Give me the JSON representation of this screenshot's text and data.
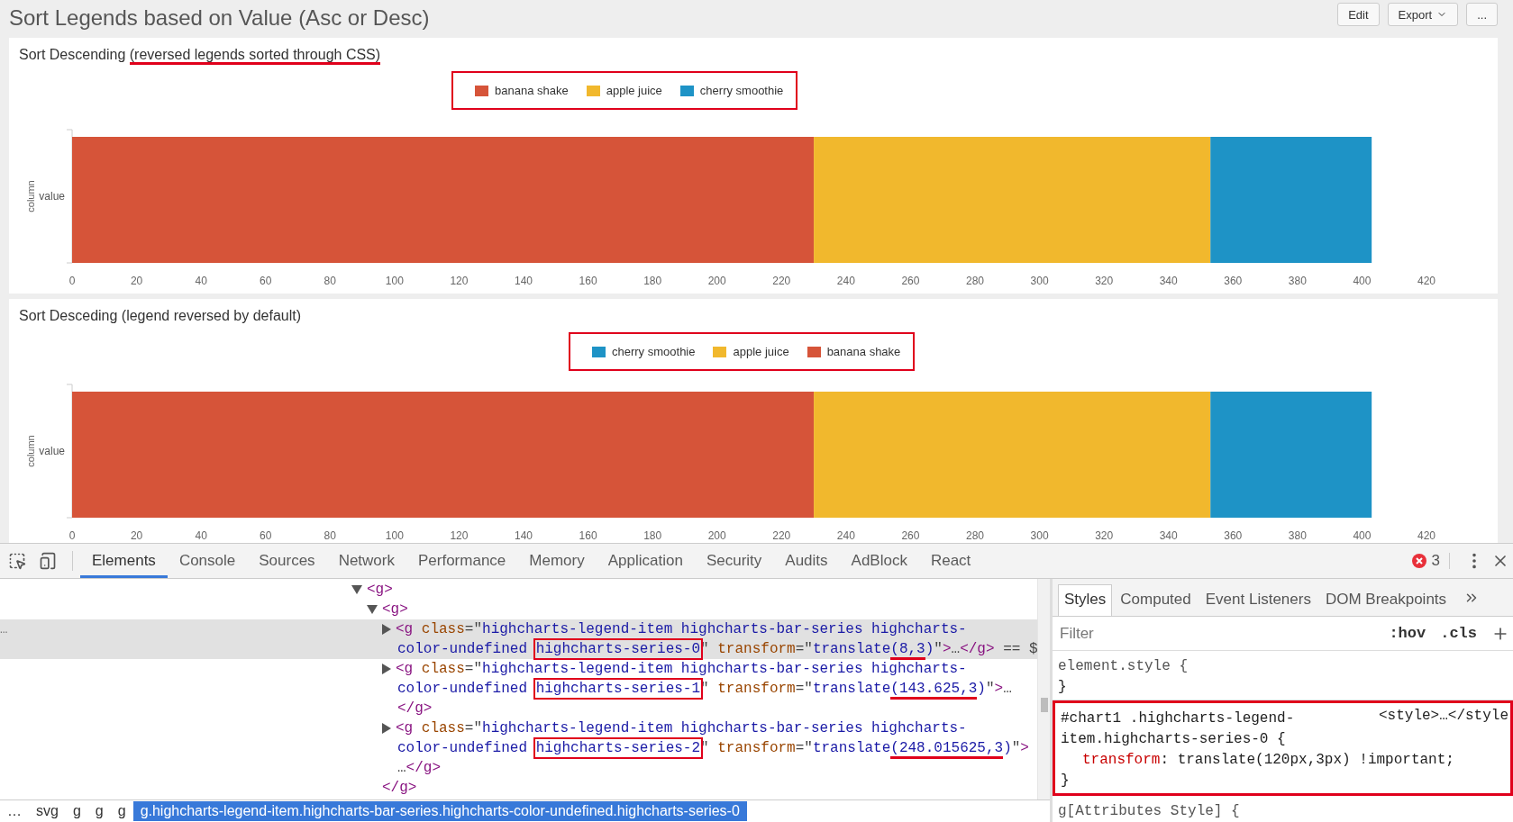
{
  "header": {
    "title": "Sort Legends based on Value (Asc or Desc)",
    "buttons": [
      {
        "label": "Edit",
        "dropdown": false
      },
      {
        "label": "Export",
        "dropdown": true
      },
      {
        "label": "...",
        "dropdown": false
      }
    ]
  },
  "charts": [
    {
      "title": [
        {
          "text": "Sort Descending ",
          "underlined": false
        },
        {
          "text": "(reversed legends sorted through CSS)",
          "underlined": true
        }
      ],
      "chart_data": {
        "type": "bar",
        "orientation": "horizontal",
        "stacked": true,
        "legend": {
          "reversed": false,
          "highlighted": true
        },
        "ylabel": "column",
        "categories": [
          "value"
        ],
        "series": [
          {
            "name": "banana shake",
            "color": "#d65439",
            "values": [
              230
            ]
          },
          {
            "name": "apple juice",
            "color": "#f1b82d",
            "values": [
              123
            ]
          },
          {
            "name": "cherry smoothie",
            "color": "#1e93c6",
            "values": [
              50
            ]
          }
        ],
        "xlim": [
          0,
          420
        ],
        "xticks": [
          0,
          20,
          40,
          60,
          80,
          100,
          120,
          140,
          160,
          180,
          200,
          220,
          240,
          260,
          280,
          300,
          320,
          340,
          360,
          380,
          400,
          420
        ]
      }
    },
    {
      "title": [
        {
          "text": "Sort Desceding (legend reversed by default)",
          "underlined": false
        }
      ],
      "chart_data": {
        "type": "bar",
        "orientation": "horizontal",
        "stacked": true,
        "legend": {
          "reversed": true,
          "highlighted": true
        },
        "ylabel": "column",
        "categories": [
          "value"
        ],
        "series": [
          {
            "name": "banana shake",
            "color": "#d65439",
            "values": [
              230
            ]
          },
          {
            "name": "apple juice",
            "color": "#f1b82d",
            "values": [
              123
            ]
          },
          {
            "name": "cherry smoothie",
            "color": "#1e93c6",
            "values": [
              50
            ]
          }
        ],
        "xlim": [
          0,
          420
        ],
        "xticks": [
          0,
          20,
          40,
          60,
          80,
          100,
          120,
          140,
          160,
          180,
          200,
          220,
          240,
          260,
          280,
          300,
          320,
          340,
          360,
          380,
          400,
          420
        ]
      }
    }
  ],
  "devtools": {
    "toolbar": {
      "tabs": [
        {
          "label": "Elements",
          "selected": true
        },
        {
          "label": "Console",
          "selected": false
        },
        {
          "label": "Sources",
          "selected": false
        },
        {
          "label": "Network",
          "selected": false
        },
        {
          "label": "Performance",
          "selected": false
        },
        {
          "label": "Memory",
          "selected": false
        },
        {
          "label": "Application",
          "selected": false
        },
        {
          "label": "Security",
          "selected": false
        },
        {
          "label": "Audits",
          "selected": false
        },
        {
          "label": "AdBlock",
          "selected": false
        },
        {
          "label": "React",
          "selected": false
        }
      ],
      "error_count": "3"
    },
    "tree": [
      {
        "expanded": true,
        "selected": false,
        "lines": [
          [
            {
              "kind": "tag",
              "text": "<g>"
            }
          ]
        ],
        "children": [
          {
            "expanded": true,
            "selected": false,
            "lines": [
              [
                {
                  "kind": "tag",
                  "text": "<g>"
                }
              ]
            ],
            "children": [
              {
                "expanded": false,
                "selected": true,
                "gutter": "…",
                "lines": [
                  [
                    {
                      "kind": "tag",
                      "text": "<g "
                    },
                    {
                      "kind": "attr",
                      "text": "class"
                    },
                    {
                      "kind": "punct",
                      "text": "=\""
                    },
                    {
                      "kind": "value",
                      "text": "highcharts-legend-item highcharts-bar-series highcharts-"
                    }
                  ],
                  [
                    {
                      "kind": "value",
                      "text": "color-undefined "
                    },
                    {
                      "kind": "value",
                      "text": "highcharts-series-0",
                      "boxed": true
                    },
                    {
                      "kind": "punct",
                      "text": "\" "
                    },
                    {
                      "kind": "attr",
                      "text": "transform"
                    },
                    {
                      "kind": "punct",
                      "text": "=\""
                    },
                    {
                      "kind": "value",
                      "text": "translate"
                    },
                    {
                      "kind": "value",
                      "text": "(8,3",
                      "underlined": true
                    },
                    {
                      "kind": "value",
                      "text": ")"
                    },
                    {
                      "kind": "punct",
                      "text": "\""
                    },
                    {
                      "kind": "tag",
                      "text": ">"
                    },
                    {
                      "kind": "punct",
                      "text": "…"
                    },
                    {
                      "kind": "tag",
                      "text": "</g>"
                    },
                    {
                      "kind": "punct",
                      "text": " == $"
                    }
                  ]
                ]
              },
              {
                "expanded": false,
                "selected": false,
                "lines": [
                  [
                    {
                      "kind": "tag",
                      "text": "<g "
                    },
                    {
                      "kind": "attr",
                      "text": "class"
                    },
                    {
                      "kind": "punct",
                      "text": "=\""
                    },
                    {
                      "kind": "value",
                      "text": "highcharts-legend-item highcharts-bar-series highcharts-"
                    }
                  ],
                  [
                    {
                      "kind": "value",
                      "text": "color-undefined "
                    },
                    {
                      "kind": "value",
                      "text": "highcharts-series-1",
                      "boxed": true
                    },
                    {
                      "kind": "punct",
                      "text": "\" "
                    },
                    {
                      "kind": "attr",
                      "text": "transform"
                    },
                    {
                      "kind": "punct",
                      "text": "=\""
                    },
                    {
                      "kind": "value",
                      "text": "translate"
                    },
                    {
                      "kind": "value",
                      "text": "(143.625,3",
                      "underlined": true
                    },
                    {
                      "kind": "value",
                      "text": ")"
                    },
                    {
                      "kind": "punct",
                      "text": "\""
                    },
                    {
                      "kind": "tag",
                      "text": ">"
                    },
                    {
                      "kind": "punct",
                      "text": "…"
                    }
                  ],
                  [
                    {
                      "kind": "tag",
                      "text": "</g>"
                    }
                  ]
                ]
              },
              {
                "expanded": false,
                "selected": false,
                "lines": [
                  [
                    {
                      "kind": "tag",
                      "text": "<g "
                    },
                    {
                      "kind": "attr",
                      "text": "class"
                    },
                    {
                      "kind": "punct",
                      "text": "=\""
                    },
                    {
                      "kind": "value",
                      "text": "highcharts-legend-item highcharts-bar-series highcharts-"
                    }
                  ],
                  [
                    {
                      "kind": "value",
                      "text": "color-undefined "
                    },
                    {
                      "kind": "value",
                      "text": "highcharts-series-2",
                      "boxed": true
                    },
                    {
                      "kind": "punct",
                      "text": "\" "
                    },
                    {
                      "kind": "attr",
                      "text": "transform"
                    },
                    {
                      "kind": "punct",
                      "text": "=\""
                    },
                    {
                      "kind": "value",
                      "text": "translate"
                    },
                    {
                      "kind": "value",
                      "text": "(248.015625,3",
                      "underlined": true
                    },
                    {
                      "kind": "value",
                      "text": ")"
                    },
                    {
                      "kind": "punct",
                      "text": "\""
                    },
                    {
                      "kind": "tag",
                      "text": ">"
                    }
                  ],
                  [
                    {
                      "kind": "punct",
                      "text": "…"
                    },
                    {
                      "kind": "tag",
                      "text": "</g>"
                    }
                  ]
                ]
              }
            ],
            "closing": [
              [
                {
                  "kind": "tag",
                  "text": "</g>"
                }
              ]
            ]
          }
        ]
      }
    ],
    "breadcrumbs": [
      {
        "label": "…",
        "selected": false
      },
      {
        "label": "svg",
        "selected": false
      },
      {
        "label": "g",
        "selected": false
      },
      {
        "label": "g",
        "selected": false
      },
      {
        "label": "g",
        "selected": false
      },
      {
        "label": "g.highcharts-legend-item.highcharts-bar-series.highcharts-color-undefined.highcharts-series-0",
        "selected": true
      }
    ],
    "styles_pane": {
      "tabs": [
        {
          "label": "Styles",
          "selected": true
        },
        {
          "label": "Computed",
          "selected": false
        },
        {
          "label": "Event Listeners",
          "selected": false
        },
        {
          "label": "DOM Breakpoints",
          "selected": false
        }
      ],
      "filter": {
        "placeholder": "Filter"
      },
      "filter_buttons": [
        ":hov",
        ".cls"
      ],
      "rules": [
        {
          "selector": "element.style {",
          "highlighted": false,
          "closing": "}"
        },
        {
          "selector": "#chart1 .highcharts-legend-item.highcharts-series-0 {",
          "source": "<style>…</style",
          "highlighted": true,
          "declarations": [
            {
              "property": "transform",
              "separator": ":",
              "value": "translate(120px,3px) !important;"
            }
          ],
          "closing": "}"
        },
        {
          "selector": "g[Attributes Style] {",
          "highlighted": false
        }
      ]
    }
  }
}
